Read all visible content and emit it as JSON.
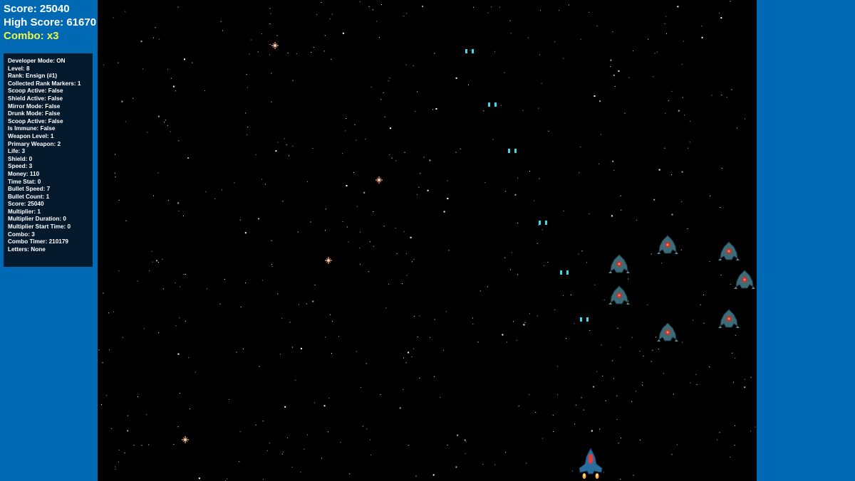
{
  "hud": {
    "score_label": "Score: 25040",
    "high_score_label": "High Score: 61670",
    "combo_label": "Combo: x3"
  },
  "debug_lines": [
    "Developer Mode: ON",
    "Level: 8",
    "Rank: Ensign (#1)",
    "Collected Rank Markers: 1",
    "Scoop Active: False",
    "Shield Active: False",
    "Mirror Mode: False",
    "Drunk Mode: False",
    "Scoop Active: False",
    "Is Immune: False",
    "Weapon Level: 1",
    "Primary Weapon: 2",
    "Life: 3",
    "Shield: 0",
    "Speed: 3",
    "Money: 110",
    "Time Stat: 0",
    "Bullet Speed: 7",
    "Bullet Count: 1",
    "Score: 25040",
    "Multiplier: 1",
    "Multiplier Duration: 0",
    "Multiplier Start Time: 0",
    "Combo: 3",
    "Combo Timer: 210179",
    "Letters: None"
  ],
  "colors": {
    "side_panel": "#0069b4",
    "playfield": "#000000",
    "combo_text": "#f5f542",
    "debug_bg": "#061a2e",
    "bullet": "#3fd8e8",
    "enemy_body": "#3d6b78",
    "enemy_core": "#c0392b",
    "player_body": "#2b6e9e",
    "player_core": "#e2403a",
    "thruster": "#ffa43a",
    "sparkle": "#ffb27a"
  },
  "icons": {
    "player": "player-ship-icon",
    "enemy": "enemy-ship-icon",
    "bullet": "bullet-pair-icon",
    "sparkle": "sparkle-icon"
  }
}
